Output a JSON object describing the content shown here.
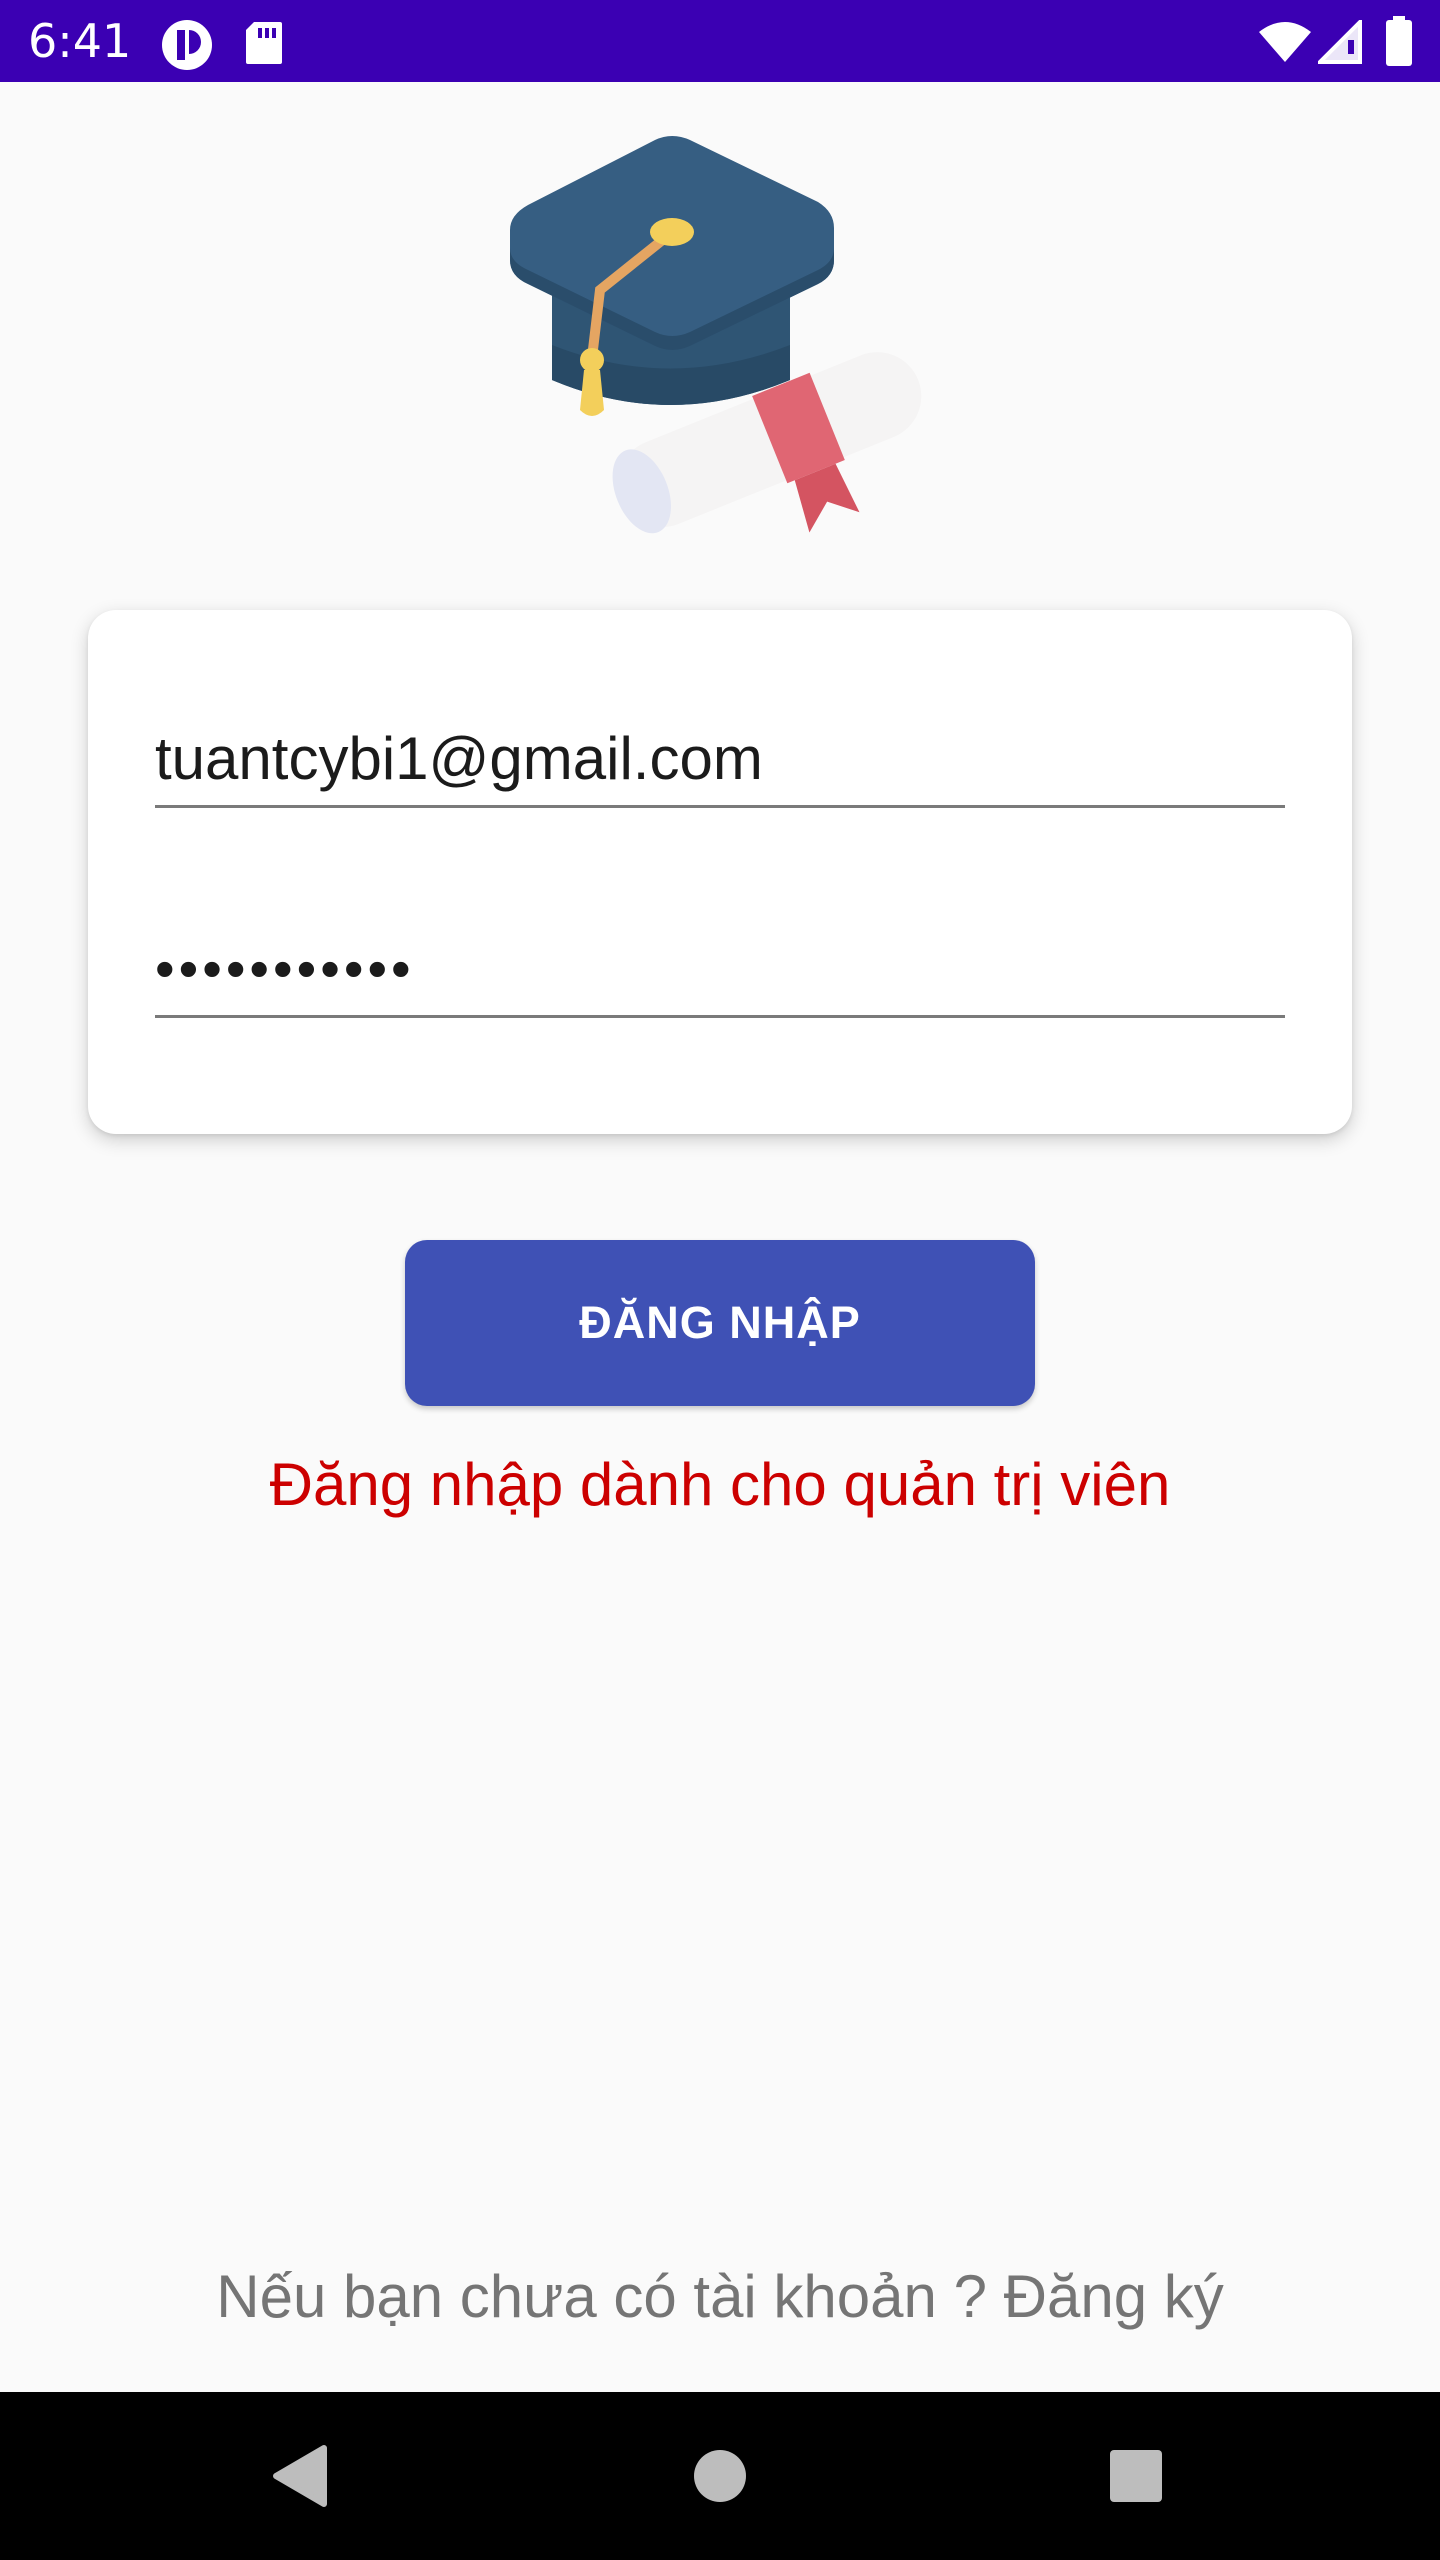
{
  "status_bar": {
    "time": "6:41",
    "left_icons": [
      "app-notification-icon",
      "sd-card-icon"
    ],
    "right_icons": [
      "wifi-icon",
      "cellular-signal-icon",
      "battery-icon"
    ],
    "color": "#3b00b3"
  },
  "logo": {
    "icon": "graduation-cap-diploma-icon"
  },
  "login_form": {
    "email_value": "tuantcybi1@gmail.com",
    "password_value": "•••••••••••"
  },
  "login_button": {
    "label": "ĐĂNG NHẬP",
    "color": "#3f51b5"
  },
  "admin_note": {
    "text": "Đăng nhập dành cho quản trị viên",
    "color": "#cc0000"
  },
  "signup_prompt": {
    "text": "Nếu bạn chưa có tài khoản ? Đăng ký"
  },
  "nav_bar": {
    "buttons": [
      "back-icon",
      "home-icon",
      "recents-icon"
    ]
  }
}
